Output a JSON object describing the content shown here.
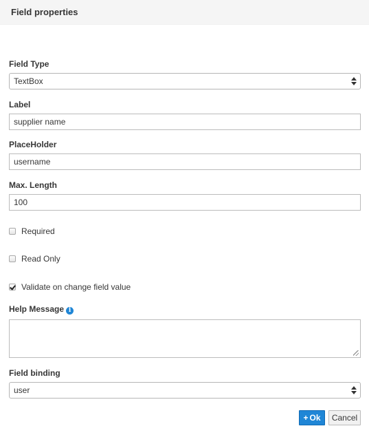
{
  "header": {
    "title": "Field properties"
  },
  "form": {
    "field_type": {
      "label": "Field Type",
      "value": "TextBox"
    },
    "label": {
      "label": "Label",
      "value": "supplier name"
    },
    "placeholder": {
      "label": "PlaceHolder",
      "value": "username"
    },
    "max_length": {
      "label": "Max. Length",
      "value": "100"
    },
    "required": {
      "label": "Required",
      "checked": false
    },
    "read_only": {
      "label": "Read Only",
      "checked": false
    },
    "validate_on_change": {
      "label": "Validate on change field value",
      "checked": true
    },
    "help_message": {
      "label": "Help Message",
      "value": "",
      "icon": "info-icon"
    },
    "field_binding": {
      "label": "Field binding",
      "value": "user"
    }
  },
  "buttons": {
    "ok_label": "Ok",
    "ok_icon": "+",
    "cancel_label": "Cancel"
  },
  "colors": {
    "accent": "#1f86d6",
    "header_bg": "#f5f5f5"
  }
}
